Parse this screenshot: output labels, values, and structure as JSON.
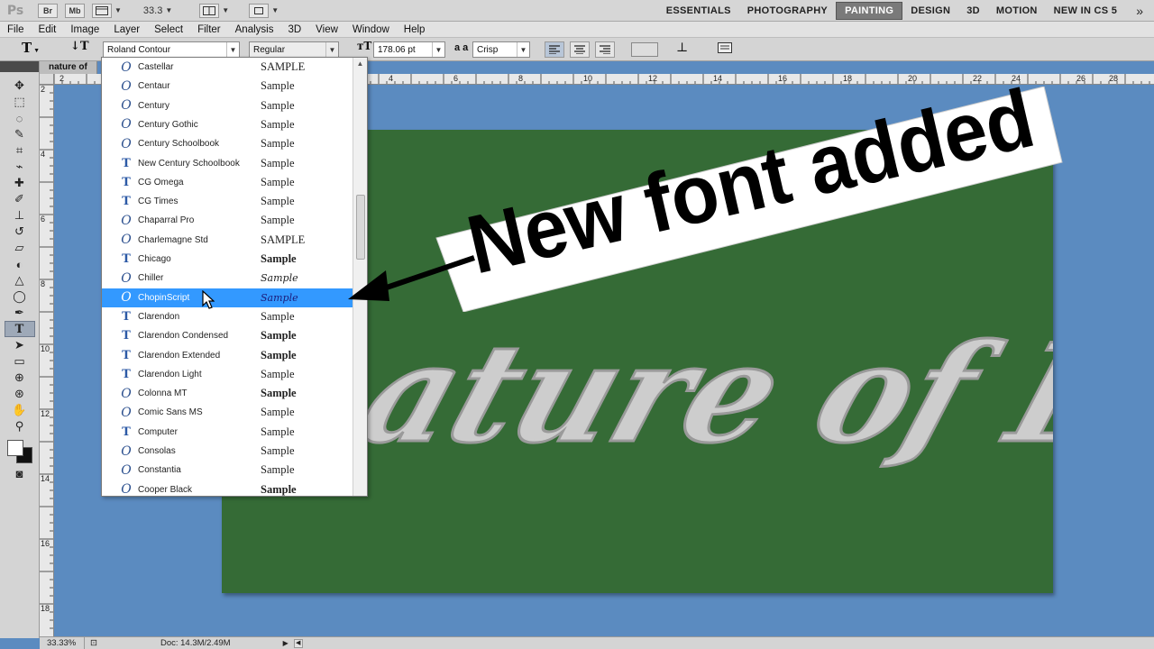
{
  "app": {
    "logo": "Ps",
    "bridge_label": "Br",
    "minibridge_label": "Mb",
    "zoom_value": "33.3",
    "workspaces": [
      "ESSENTIALS",
      "PHOTOGRAPHY",
      "PAINTING",
      "DESIGN",
      "3D",
      "MOTION",
      "NEW IN CS 5"
    ],
    "active_workspace": "PAINTING",
    "more_label": "»"
  },
  "menu": [
    "File",
    "Edit",
    "Image",
    "Layer",
    "Select",
    "Filter",
    "Analysis",
    "3D",
    "View",
    "Window",
    "Help"
  ],
  "options": {
    "font_family": "Roland Contour",
    "font_style": "Regular",
    "font_size": "178.06 pt",
    "aa_label": "a a",
    "anti_alias": "Crisp"
  },
  "document": {
    "tab_title": "nature of",
    "artwork_text": "nature of BD",
    "ruler_marks": [
      "2",
      "4",
      "6",
      "8",
      "10",
      "12",
      "14",
      "16",
      "18",
      "20",
      "22",
      "24",
      "26",
      "28"
    ]
  },
  "status": {
    "zoom": "33.33%",
    "doc_size": "Doc: 14.3M/2.49M"
  },
  "font_list": {
    "items": [
      {
        "name": "Castellar",
        "sample": "SAMPLE",
        "type": "otf",
        "style": "caps"
      },
      {
        "name": "Centaur",
        "sample": "Sample",
        "type": "otf",
        "style": "normal"
      },
      {
        "name": "Century",
        "sample": "Sample",
        "type": "otf",
        "style": "normal"
      },
      {
        "name": "Century Gothic",
        "sample": "Sample",
        "type": "otf",
        "style": "normal"
      },
      {
        "name": "Century Schoolbook",
        "sample": "Sample",
        "type": "otf",
        "style": "normal"
      },
      {
        "name": "New Century Schoolbook",
        "sample": "Sample",
        "type": "tt",
        "style": "normal"
      },
      {
        "name": "CG Omega",
        "sample": "Sample",
        "type": "tt",
        "style": "normal"
      },
      {
        "name": "CG Times",
        "sample": "Sample",
        "type": "tt",
        "style": "normal"
      },
      {
        "name": "Chaparral Pro",
        "sample": "Sample",
        "type": "otf",
        "style": "normal"
      },
      {
        "name": "Charlemagne Std",
        "sample": "SAMPLE",
        "type": "otf",
        "style": "caps"
      },
      {
        "name": "Chicago",
        "sample": "Sample",
        "type": "tt",
        "style": "bold"
      },
      {
        "name": "Chiller",
        "sample": "Sample",
        "type": "otf",
        "style": "script"
      },
      {
        "name": "ChopinScript",
        "sample": "Sample",
        "type": "otf",
        "style": "script"
      },
      {
        "name": "Clarendon",
        "sample": "Sample",
        "type": "tt",
        "style": "normal"
      },
      {
        "name": "Clarendon Condensed",
        "sample": "Sample",
        "type": "tt",
        "style": "bold"
      },
      {
        "name": "Clarendon Extended",
        "sample": "Sample",
        "type": "tt",
        "style": "bold"
      },
      {
        "name": "Clarendon Light",
        "sample": "Sample",
        "type": "tt",
        "style": "normal"
      },
      {
        "name": "Colonna MT",
        "sample": "Sample",
        "type": "otf",
        "style": "bold"
      },
      {
        "name": "Comic Sans MS",
        "sample": "Sample",
        "type": "otf",
        "style": "normal"
      },
      {
        "name": "Computer",
        "sample": "Sample",
        "type": "tt",
        "style": "normal"
      },
      {
        "name": "Consolas",
        "sample": "Sample",
        "type": "otf",
        "style": "normal"
      },
      {
        "name": "Constantia",
        "sample": "Sample",
        "type": "otf",
        "style": "normal"
      },
      {
        "name": "Cooper Black",
        "sample": "Sample",
        "type": "otf",
        "style": "bold"
      }
    ],
    "selected_index": 12
  },
  "annotation": {
    "text": "New font added"
  },
  "icons": {
    "move": "move-icon",
    "marquee": "marquee-icon",
    "lasso": "lasso-icon",
    "crop": "crop-icon",
    "eyedropper": "eyedropper-icon",
    "brush": "brush-icon",
    "type": "type-icon",
    "hand": "hand-icon",
    "zoom": "zoom-icon"
  }
}
